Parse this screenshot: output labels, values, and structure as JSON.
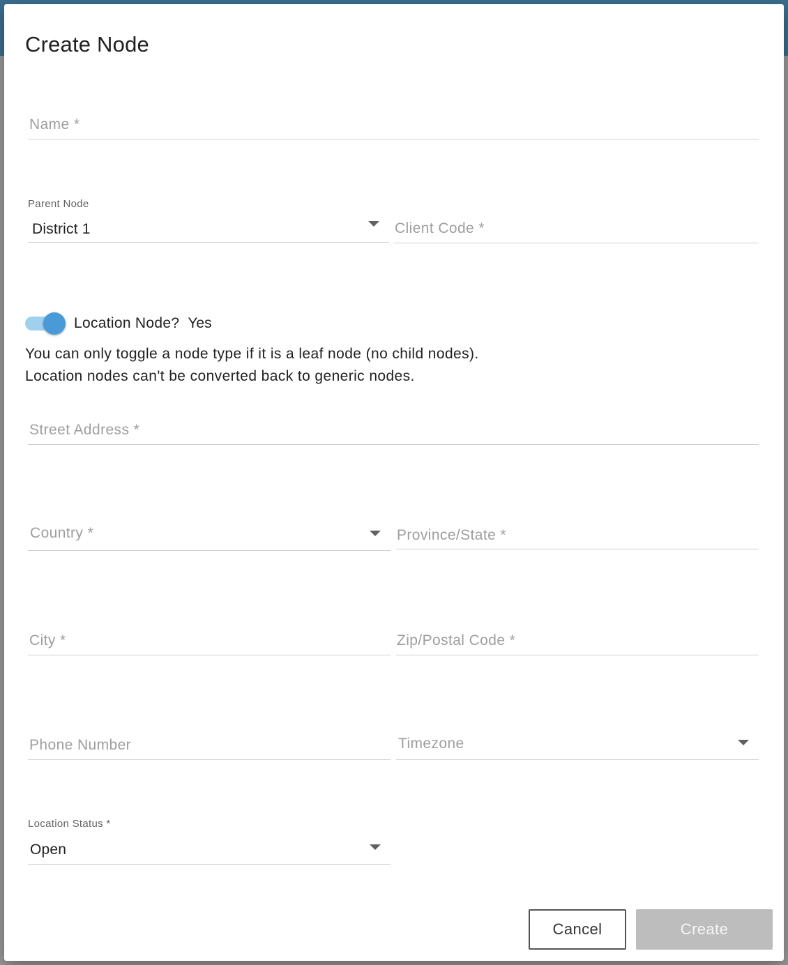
{
  "dialog": {
    "title": "Create Node",
    "name_placeholder": "Name *",
    "parent_node": {
      "label": "Parent Node",
      "value": "District 1"
    },
    "client_code_placeholder": "Client Code *",
    "location_toggle": {
      "label": "Location Node?",
      "value": "Yes",
      "checked": true
    },
    "help_line_1": "You can only toggle a node type if it is a leaf node (no child nodes).",
    "help_line_2": "Location nodes can't be converted back to generic nodes.",
    "street_placeholder": "Street Address *",
    "country_placeholder": "Country *",
    "province_placeholder": "Province/State *",
    "city_placeholder": "City *",
    "zip_placeholder": "Zip/Postal Code *",
    "phone_placeholder": "Phone Number",
    "timezone_placeholder": "Timezone",
    "location_status": {
      "label": "Location Status *",
      "value": "Open"
    },
    "cancel_label": "Cancel",
    "create_label": "Create"
  },
  "colors": {
    "accent": "#4a9ad8",
    "toggle_track": "#9fd1ee",
    "disabled_button": "#bdbdbd",
    "header_bar": "#3a6e8f"
  }
}
